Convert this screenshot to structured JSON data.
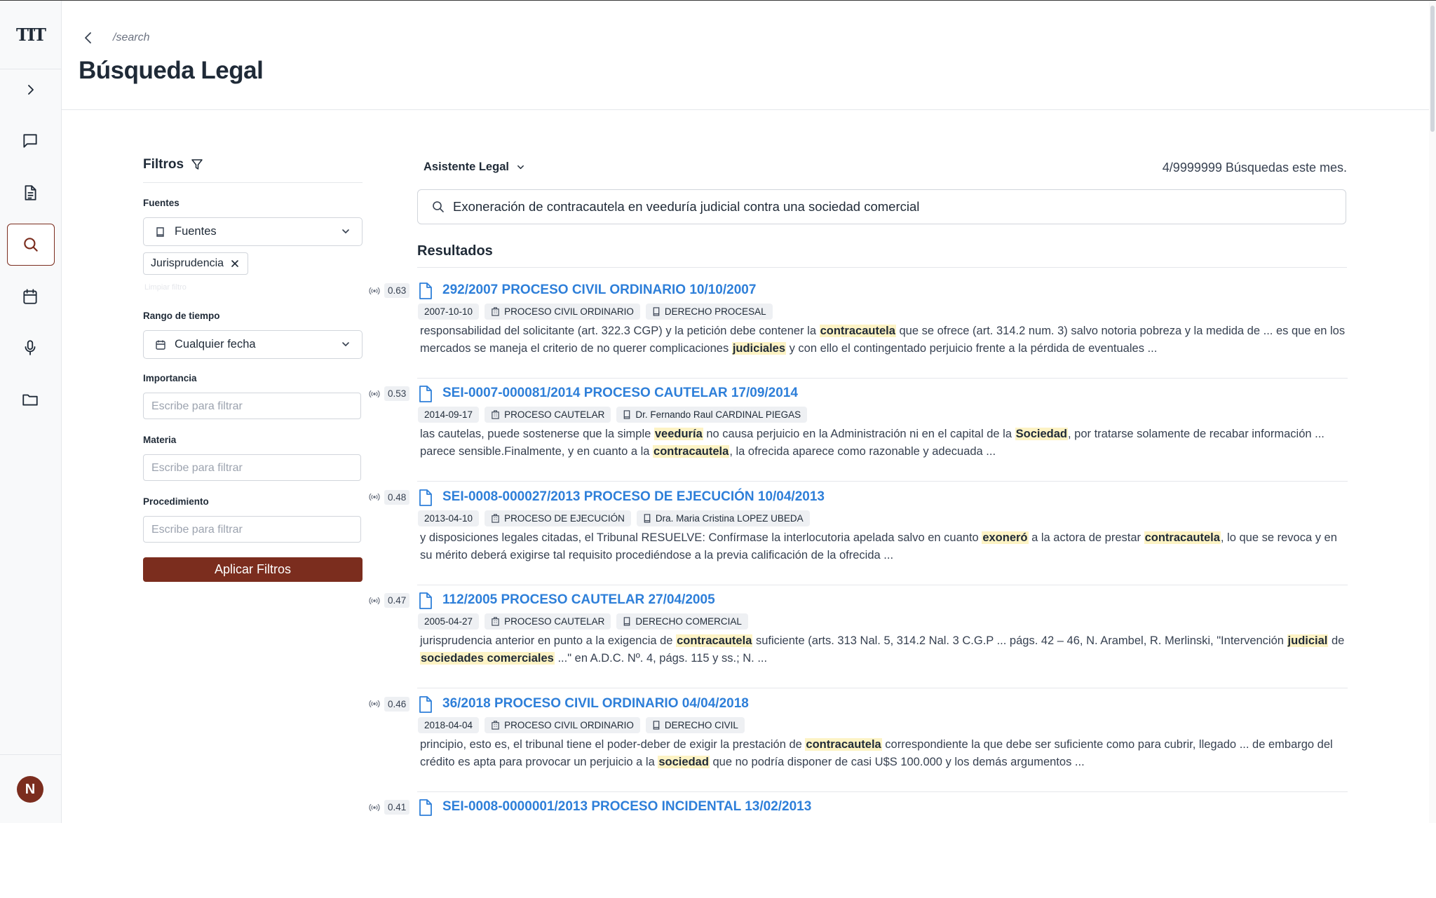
{
  "app": {
    "logo": "TIT",
    "user_initial": "N",
    "path": "/search",
    "title": "Búsqueda Legal"
  },
  "sidebar": {
    "items": [
      "chat-icon",
      "document-icon",
      "search-icon",
      "calendar-icon",
      "microphone-icon",
      "folder-icon"
    ],
    "active": "search-icon"
  },
  "filters": {
    "title": "Filtros",
    "sources_label": "Fuentes",
    "sources_select": "Fuentes",
    "chip": "Jurisprudencia",
    "clear": "Limpiar filtro",
    "time_label": "Rango de tiempo",
    "time_select": "Cualquier fecha",
    "importance_label": "Importancia",
    "importance_placeholder": "Escribe para filtrar",
    "subject_label": "Materia",
    "subject_placeholder": "Escribe para filtrar",
    "procedure_label": "Procedimiento",
    "procedure_placeholder": "Escribe para filtrar",
    "apply": "Aplicar Filtros"
  },
  "main": {
    "assistant": "Asistente Legal",
    "quota": "4/9999999 Búsquedas este mes.",
    "query": "Exoneración de contracautela en veeduría judicial contra una sociedad comercial",
    "results_title": "Resultados"
  },
  "results": [
    {
      "score": "0.63",
      "title": "292/2007 PROCESO CIVIL ORDINARIO 10/10/2007",
      "date": "2007-10-10",
      "type": "PROCESO CIVIL ORDINARIO",
      "tag": "DERECHO PROCESAL",
      "snippet": [
        {
          "t": "responsabilidad del solicitante (art. 322.3 CGP) y la petición debe contener la "
        },
        {
          "t": "contracautela",
          "h": true
        },
        {
          "t": " que se ofrece (art. 314.2 num. 3) salvo notoria pobreza y la medida de ... es que en los mercados se maneja el criterio de no querer complicaciones "
        },
        {
          "t": "judiciales",
          "h": true
        },
        {
          "t": " y con ello el contingentado perjuicio frente a la pérdida de eventuales ..."
        }
      ]
    },
    {
      "score": "0.53",
      "title": "SEI-0007-000081/2014 PROCESO CAUTELAR 17/09/2014",
      "date": "2014-09-17",
      "type": "PROCESO CAUTELAR",
      "tag": "Dr. Fernando Raul CARDINAL PIEGAS",
      "snippet": [
        {
          "t": "las cautelas, puede sostenerse que la simple "
        },
        {
          "t": "veeduría",
          "h": true
        },
        {
          "t": " no causa perjuicio en la Administración ni en el capital de la "
        },
        {
          "t": "Sociedad",
          "h": true
        },
        {
          "t": ", por tratarse solamente de recabar información ... parece sensible.Finalmente, y en cuanto a la "
        },
        {
          "t": "contracautela",
          "h": true
        },
        {
          "t": ", la ofrecida aparece como razonable y adecuada ..."
        }
      ]
    },
    {
      "score": "0.48",
      "title": "SEI-0008-000027/2013 PROCESO DE EJECUCIÓN 10/04/2013",
      "date": "2013-04-10",
      "type": "PROCESO DE EJECUCIÓN",
      "tag": "Dra. Maria Cristina LOPEZ UBEDA",
      "snippet": [
        {
          "t": "y disposiciones legales citadas, el Tribunal RESUELVE: Confírmase la interlocutoria apelada salvo en cuanto "
        },
        {
          "t": "exoneró",
          "h": true
        },
        {
          "t": " a la actora de prestar "
        },
        {
          "t": "contracautela",
          "h": true
        },
        {
          "t": ", lo que se revoca y en su mérito deberá exigirse tal requisito procediéndose a la previa calificación de la ofrecida ..."
        }
      ]
    },
    {
      "score": "0.47",
      "title": "112/2005 PROCESO CAUTELAR 27/04/2005",
      "date": "2005-04-27",
      "type": "PROCESO CAUTELAR",
      "tag": "DERECHO COMERCIAL",
      "snippet": [
        {
          "t": "jurisprudencia anterior en punto a la exigencia de "
        },
        {
          "t": "contracautela",
          "h": true
        },
        {
          "t": " suficiente (arts. 313 Nal. 5, 314.2 Nal. 3 C.G.P ... págs. 42 – 46, N. Arambel, R. Merlinski, \"Intervención "
        },
        {
          "t": "judicial",
          "h": true
        },
        {
          "t": " de "
        },
        {
          "t": "sociedades comerciales",
          "h": true
        },
        {
          "t": " ...\" en A.D.C. Nº. 4, págs. 115 y ss.; N. ..."
        }
      ]
    },
    {
      "score": "0.46",
      "title": "36/2018 PROCESO CIVIL ORDINARIO 04/04/2018",
      "date": "2018-04-04",
      "type": "PROCESO CIVIL ORDINARIO",
      "tag": "DERECHO CIVIL",
      "snippet": [
        {
          "t": "principio, esto es, el tribunal tiene el poder-deber de exigir la prestación de "
        },
        {
          "t": "contracautela",
          "h": true
        },
        {
          "t": " correspondiente la que debe ser suficiente como para cubrir, llegado ... de embargo del crédito es apta para provocar un perjuicio a la "
        },
        {
          "t": "sociedad",
          "h": true
        },
        {
          "t": " que no podría disponer de casi U$S 100.000 y los demás argumentos ..."
        }
      ]
    },
    {
      "score": "0.41",
      "title": "SEI-0008-0000001/2013 PROCESO INCIDENTAL 13/02/2013",
      "date": "",
      "type": "",
      "tag": "",
      "snippet": []
    }
  ]
}
